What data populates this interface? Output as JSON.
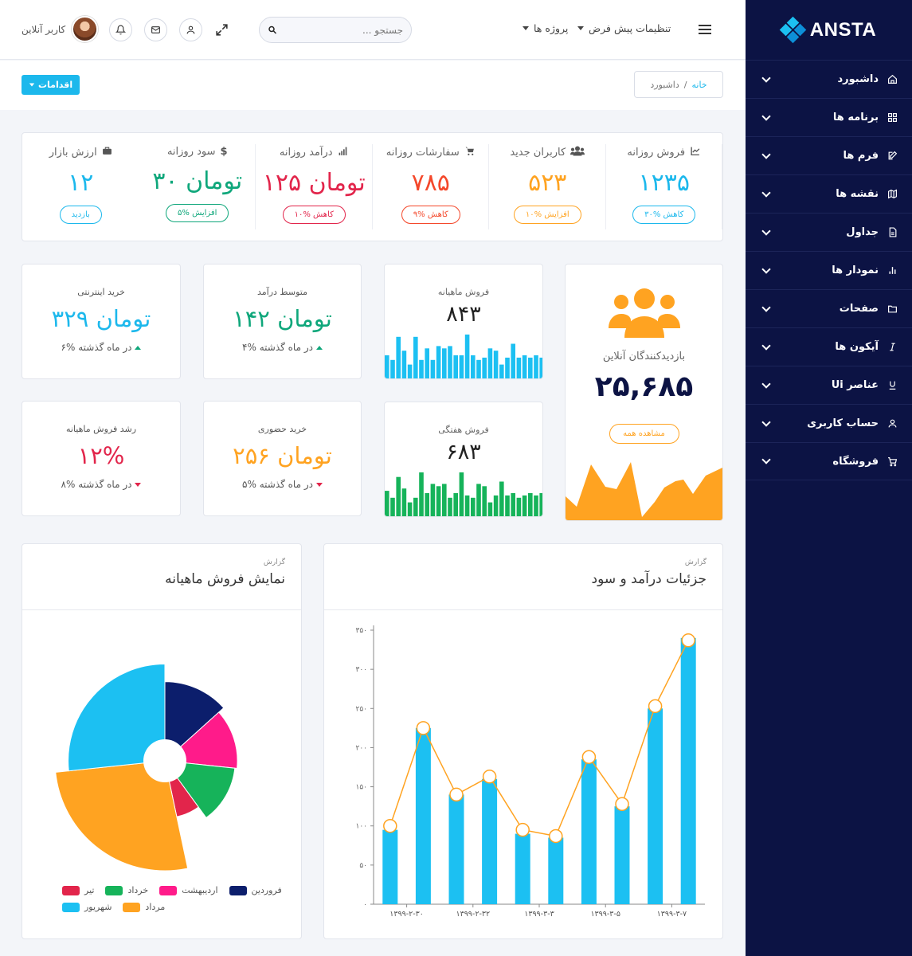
{
  "brand": {
    "name": "ANSTA"
  },
  "sidebar": {
    "items": [
      {
        "label": "داشبورد",
        "icon": "home-icon"
      },
      {
        "label": "برنامه ها",
        "icon": "grid-icon"
      },
      {
        "label": "فرم ها",
        "icon": "edit-icon"
      },
      {
        "label": "نقشه ها",
        "icon": "map-icon"
      },
      {
        "label": "جداول",
        "icon": "document-icon"
      },
      {
        "label": "نمودار ها",
        "icon": "bar-chart-icon"
      },
      {
        "label": "صفحات",
        "icon": "folder-icon"
      },
      {
        "label": "آیکون ها",
        "icon": "italic-icon"
      },
      {
        "label": "عناصر Ui",
        "icon": "underline-icon"
      },
      {
        "label": "حساب کاربری",
        "icon": "user-icon"
      },
      {
        "label": "فروشگاه",
        "icon": "cart-icon"
      }
    ]
  },
  "header": {
    "user_name": "کاربر آنلاین",
    "search_placeholder": "جستجو ...",
    "projects_label": "پروژه ها",
    "settings_label": "تنظیمات پیش فرض"
  },
  "subbar": {
    "actions_label": "اقدامات",
    "crumb_home": "خانه",
    "crumb_sep": "/",
    "crumb_current": "داشبورد"
  },
  "stats": [
    {
      "title": "ارزش بازار",
      "value": "۱۲",
      "badge": "بازدید",
      "color": "#1cb8ec",
      "icon": "briefcase-icon"
    },
    {
      "title": "سود روزانه",
      "value": "۳۰ تومان",
      "badge": "۵% افزایش",
      "color": "#0fa77b",
      "icon": "dollar-icon"
    },
    {
      "title": "درآمد روزانه",
      "value": "۱۲۵ تومان",
      "badge": "۱۰% کاهش",
      "color": "#e2254b",
      "icon": "signal-icon"
    },
    {
      "title": "سفارشات روزانه",
      "value": "۷۸۵",
      "badge": "۹% کاهش",
      "color": "#f4482b",
      "icon": "cart-icon"
    },
    {
      "title": "کاربران جدید",
      "value": "۵۲۳",
      "badge": "۱۰% افزایش",
      "color": "#ffa321",
      "icon": "users-icon"
    },
    {
      "title": "فروش روزانه",
      "value": "۱۲۳۵",
      "badge": "۳۰% کاهش",
      "color": "#1cb8ec",
      "icon": "line-chart-icon"
    }
  ],
  "kpis": {
    "online_purchase": {
      "title": "خرید اینترنتی",
      "value": "۳۲۹ تومان",
      "foot": "۶% در ماه گذشته",
      "color": "#1cb8ec"
    },
    "avg_income": {
      "title": "متوسط درآمد",
      "value": "۱۴۲ تومان",
      "foot": "۴% در ماه گذشته",
      "color": "#0fa77b"
    },
    "monthly_growth": {
      "title": "رشد فروش ماهیانه",
      "value": "۱۲%",
      "foot": "۸% در ماه گذشته",
      "color": "#e2254b"
    },
    "in_person": {
      "title": "خرید حضوری",
      "value": "۲۵۶ تومان",
      "foot": "۵% در ماه گذشته",
      "color": "#ffa321"
    }
  },
  "monthly_sales": {
    "title": "فروش ماهیانه",
    "value": "۸۴۳",
    "color": "#1cc0f2",
    "bars": [
      0.5,
      0.4,
      0.9,
      0.6,
      0.3,
      0.9,
      0.4,
      0.65,
      0.4,
      0.7,
      0.65,
      0.7,
      0.5,
      0.5,
      0.95,
      0.5,
      0.4,
      0.45,
      0.65,
      0.6,
      0.3,
      0.45,
      0.75,
      0.45,
      0.5,
      0.45,
      0.5,
      0.45
    ]
  },
  "weekly_sales": {
    "title": "فروش هفتگی",
    "value": "۶۸۳",
    "color": "#16b35a",
    "bars": [
      0.55,
      0.4,
      0.85,
      0.6,
      0.3,
      0.4,
      0.95,
      0.5,
      0.7,
      0.65,
      0.7,
      0.4,
      0.5,
      0.95,
      0.45,
      0.4,
      0.7,
      0.65,
      0.3,
      0.45,
      0.75,
      0.45,
      0.5,
      0.4,
      0.45,
      0.5,
      0.45,
      0.5
    ]
  },
  "visitors": {
    "title": "بازدیدکنندگان آنلاین",
    "value": "۲۵,۶۸۵",
    "button": "مشاهده همه",
    "color": "#ffa321"
  },
  "income_chart": {
    "kicker": "گزارش",
    "title": "جزئیات درآمد و سود"
  },
  "pie_chart": {
    "kicker": "گزارش",
    "title": "نمایش فروش ماهیانه"
  },
  "chart_data": [
    {
      "type": "bar",
      "title": "جزئیات درآمد و سود",
      "ylim": [
        0,
        350
      ],
      "yticks": [
        "۰",
        "۵۰",
        "۱۰۰",
        "۱۵۰",
        "۲۰۰",
        "۲۵۰",
        "۳۰۰",
        "۳۵۰"
      ],
      "xtick_labels": [
        "۱۳۹۹-۲-۳۰",
        "۱۳۹۹-۲-۳۲",
        "۱۳۹۹-۳-۳",
        "۱۳۹۹-۳-۵",
        "۱۳۹۹-۳-۷"
      ],
      "series": [
        {
          "type": "bar",
          "color": "#1cc0f2",
          "values": [
            95,
            225,
            140,
            160,
            90,
            85,
            185,
            125,
            250,
            340
          ]
        },
        {
          "type": "line",
          "color": "#ffa321",
          "values": [
            100,
            225,
            140,
            163,
            95,
            87,
            188,
            128,
            253,
            337
          ]
        }
      ]
    },
    {
      "type": "pie",
      "title": "نمایش فروش ماهیانه",
      "slices": [
        {
          "label": "فروردین",
          "value": 1,
          "radius": 0.72,
          "color": "#0c1e6c"
        },
        {
          "label": "اردیبهشت",
          "value": 1,
          "radius": 0.66,
          "color": "#ff1b8a"
        },
        {
          "label": "خرداد",
          "value": 1,
          "radius": 0.64,
          "color": "#16b35a"
        },
        {
          "label": "تیر",
          "value": 0.5,
          "radius": 0.52,
          "color": "#e2254b"
        },
        {
          "label": "مرداد",
          "value": 2,
          "radius": 1.0,
          "color": "#ffa321"
        },
        {
          "label": "شهریور",
          "value": 2,
          "radius": 0.88,
          "color": "#1cc0f2"
        }
      ]
    }
  ]
}
